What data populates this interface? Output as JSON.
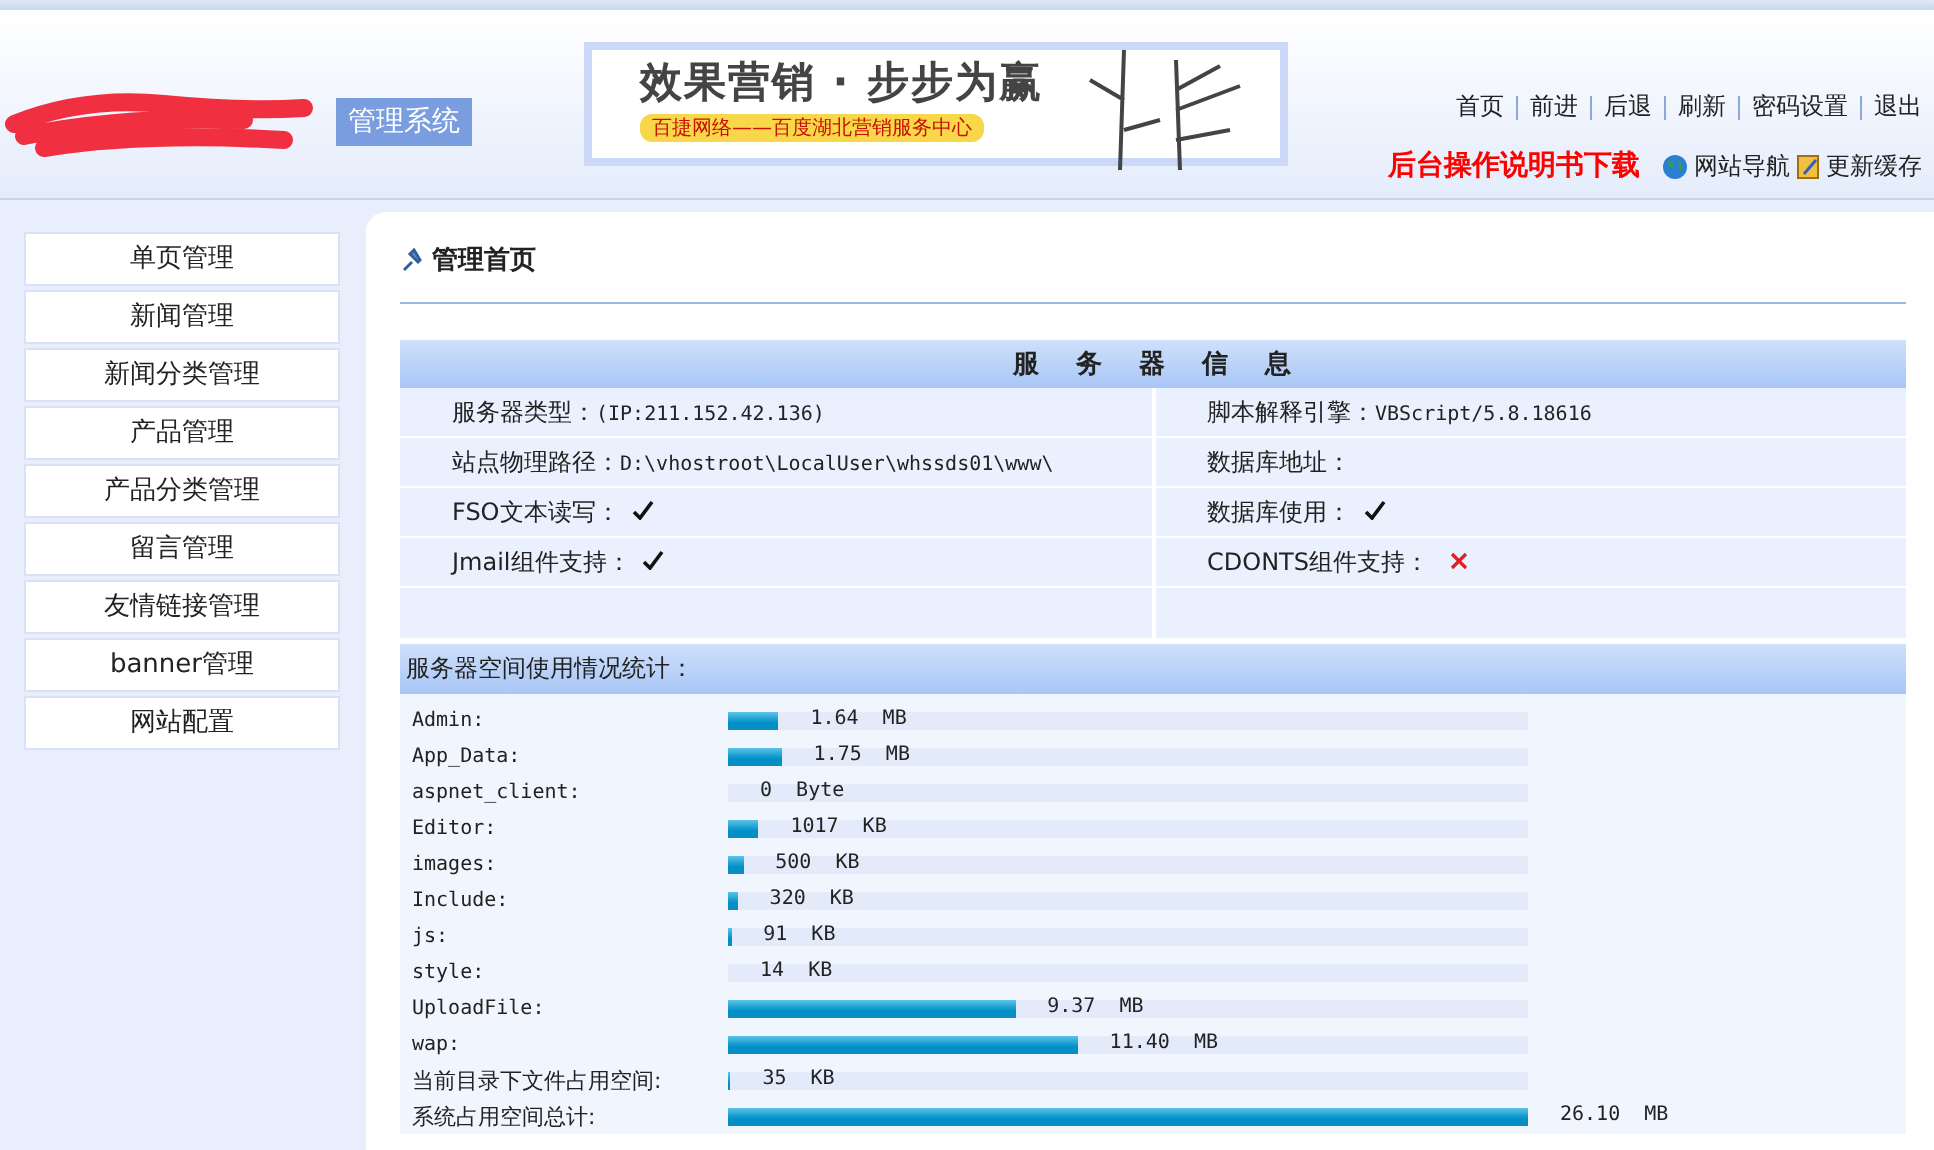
{
  "header": {
    "system_name": "管理系统",
    "banner": {
      "headline": "效果营销 · 步步为赢",
      "tagline": "百捷网络——百度湖北营销服务中心"
    },
    "nav": [
      "首页",
      "前进",
      "后退",
      "刷新",
      "密码设置",
      "退出"
    ],
    "manual_link": "后台操作说明书下载",
    "site_nav": "网站导航",
    "refresh_cache": "更新缓存"
  },
  "sidebar": {
    "items": [
      "单页管理",
      "新闻管理",
      "新闻分类管理",
      "产品管理",
      "产品分类管理",
      "留言管理",
      "友情链接管理",
      "banner管理",
      "网站配置"
    ]
  },
  "page_title": "管理首页",
  "server_info": {
    "title": "服 务 器 信 息",
    "rows": [
      [
        {
          "label": "服务器类型：",
          "value": "(IP:211.152.42.136)"
        },
        {
          "label": "脚本解释引擎：",
          "value": "VBScript/5.8.18616"
        }
      ],
      [
        {
          "label": "站点物理路径：",
          "value": "D:\\vhostroot\\LocalUser\\whssds01\\www\\"
        },
        {
          "label": "数据库地址："
        }
      ],
      [
        {
          "label": "FSO文本读写：",
          "supported": true
        },
        {
          "label": "数据库使用：",
          "supported": true
        }
      ],
      [
        {
          "label": "Jmail组件支持：",
          "supported": true
        },
        {
          "label": "CDONTS组件支持：",
          "supported": false
        }
      ]
    ]
  },
  "space": {
    "title": "服务器空间使用情况统计：",
    "rows": [
      {
        "name": "Admin:",
        "level": 0.063,
        "size": "1.64",
        "unit": "MB"
      },
      {
        "name": "App_Data:",
        "level": 0.067,
        "size": "1.75",
        "unit": "MB"
      },
      {
        "name": "aspnet_client:",
        "size": "0",
        "unit": "Byte"
      },
      {
        "name": "Editor:",
        "level": 0.038,
        "size": "1017",
        "unit": "KB"
      },
      {
        "name": "images:",
        "level": 0.019,
        "size": "500",
        "unit": "KB"
      },
      {
        "name": "Include:",
        "level": 0.012,
        "size": "320",
        "unit": "KB"
      },
      {
        "name": "js:",
        "level": 0.004,
        "size": "91",
        "unit": "KB"
      },
      {
        "name": "style:",
        "size": "14",
        "unit": "KB"
      },
      {
        "name": "UploadFile:",
        "level": 0.359,
        "size": "9.37",
        "unit": "MB"
      },
      {
        "name": "wap:",
        "level": 0.437,
        "size": "11.40",
        "unit": "MB"
      },
      {
        "name": "当前目录下文件占用空间:",
        "level": 0.003,
        "size": "35",
        "unit": "KB"
      },
      {
        "name": "系统占用空间总计:",
        "level": 1,
        "size": "26.10",
        "unit": "MB"
      }
    ]
  }
}
